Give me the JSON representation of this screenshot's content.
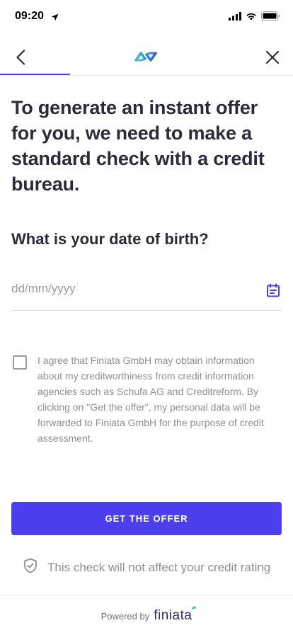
{
  "status_bar": {
    "time": "09:20",
    "icons": [
      "location-arrow-icon",
      "cellular-signal-icon",
      "wifi-icon",
      "battery-icon"
    ]
  },
  "nav": {
    "back_icon": "chevron-left-icon",
    "logo_icon": "finiata-infinity-logo",
    "close_icon": "close-icon",
    "progress_fraction": 0.24,
    "progress_color": "#4b3ff0"
  },
  "main": {
    "headline": "To generate an instant offer for you, we need to make a standard check with a credit bureau.",
    "question": "What is your date of birth?",
    "date_field": {
      "value": "",
      "placeholder": "dd/mm/yyyy",
      "icon": "calendar-icon"
    },
    "consent": {
      "checked": false,
      "text": "I agree that Finiata GmbH may obtain information about my creditworthiness from credit information agencies such as Schufa AG and Creditreform. By clicking on \"Get the offer\", my personal data will be forwarded to Finiata GmbH for the purpose of credit assessment."
    },
    "cta_label": "GET THE OFFER",
    "note": {
      "icon": "shield-check-icon",
      "text": "This check will not affect your credit rating"
    }
  },
  "footer": {
    "powered_by": "Powered by",
    "brand": "finiata"
  },
  "colors": {
    "accent": "#4b3ff0",
    "logo_teal": "#2ec6d6",
    "logo_blue": "#3b5bdb",
    "text": "#2b2b3a",
    "muted": "#8e8e98"
  }
}
